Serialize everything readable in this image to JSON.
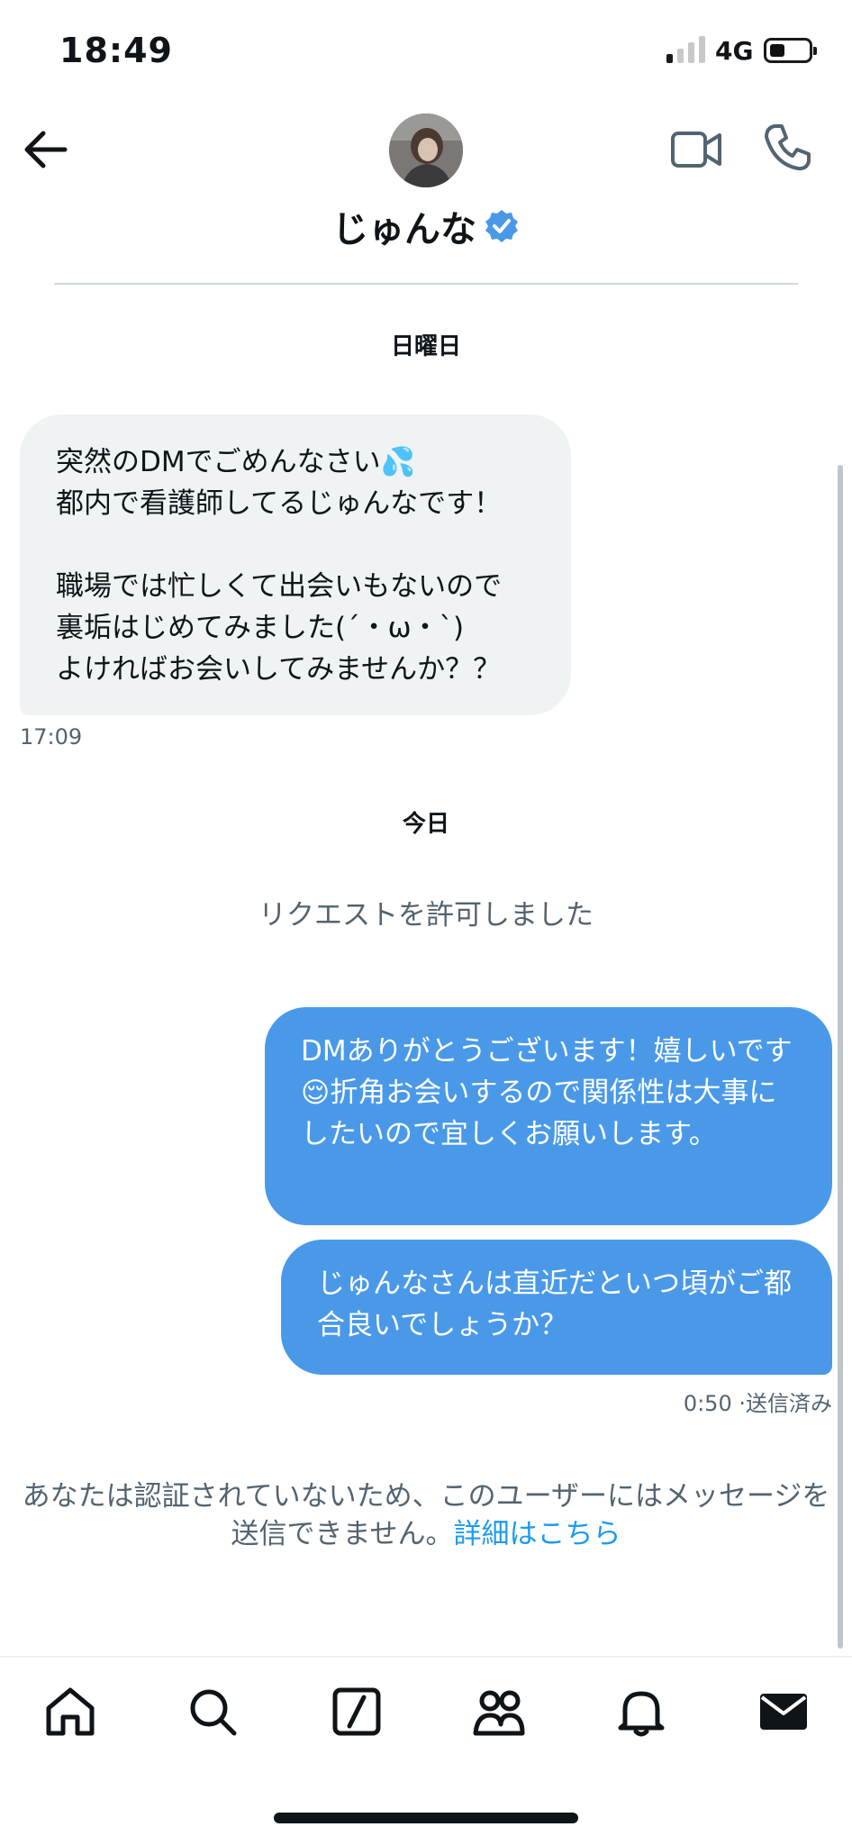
{
  "status_bar": {
    "time": "18:49",
    "network": "4G",
    "battery_level_percent": 25
  },
  "header": {
    "contact_name": "じゅんな",
    "icons": [
      "back-arrow-icon",
      "video-call-icon",
      "phone-call-icon",
      "verified-badge-icon"
    ]
  },
  "conversation": {
    "day_1": "日曜日",
    "incoming_message": {
      "lines": [
        "突然のDMでごめんなさい💦",
        "都内で看護師してるじゅんなです！",
        "",
        "職場では忙しくて出会いもないので",
        "裏垢はじめてみました(´・ω・`)",
        "よければお会いしてみませんか？？"
      ],
      "time": "17:09"
    },
    "day_2": "今日",
    "system_message": "リクエストを許可しました",
    "outgoing_messages": [
      "DMありがとうございます！嬉しいです😌折角お会いするので関係性は大事にしたいので宜しくお願いします。",
      "じゅんなさんは直近だといつ頃がご都合良いでしょうか？"
    ],
    "outgoing_time": "0:50",
    "outgoing_status": "·送信済み"
  },
  "notice": {
    "text": "あなたは認証されていないため、このユーザーにはメッセージを送信できません。",
    "link": "詳細はこちら"
  },
  "bottom_nav": {
    "items": [
      "home-icon",
      "search-icon",
      "compose-icon",
      "communities-icon",
      "notifications-icon",
      "messages-icon"
    ]
  },
  "colors": {
    "accent": "#1d9bf0",
    "bubble_out": "#4a99e9",
    "bubble_in": "#eff3f4",
    "secondary_text": "#536471"
  }
}
